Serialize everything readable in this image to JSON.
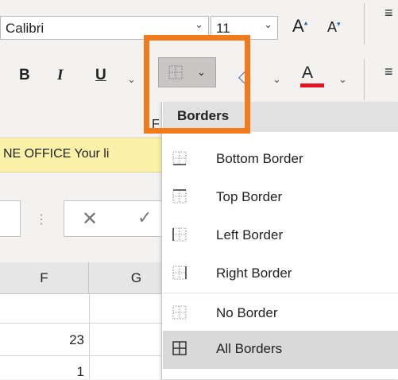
{
  "ribbon": {
    "font_name": "Calibri",
    "font_size": "11",
    "bold_label": "B",
    "italic_label": "I",
    "underline_label": "U",
    "font_color_label": "A",
    "font_group_letter": "F",
    "font_color_underline_color": "#e81123"
  },
  "notification": {
    "text": "NE OFFICE  Your li"
  },
  "grid": {
    "columns": [
      "F",
      "G"
    ],
    "cells": [
      "23",
      "1"
    ]
  },
  "borders_menu": {
    "header": "Borders",
    "items": [
      {
        "label": "Bottom Border",
        "icon": "bottom-border-icon"
      },
      {
        "label": "Top Border",
        "icon": "top-border-icon"
      },
      {
        "label": "Left Border",
        "icon": "left-border-icon"
      },
      {
        "label": "Right Border",
        "icon": "right-border-icon"
      },
      {
        "label": "No Border",
        "icon": "no-border-icon"
      },
      {
        "label": "All Borders",
        "icon": "all-borders-icon",
        "selected": true
      }
    ]
  },
  "colors": {
    "highlight": "#f27a1a",
    "notification_bg": "#fbf1a9",
    "selected_item_bg": "#d9d9d9"
  }
}
